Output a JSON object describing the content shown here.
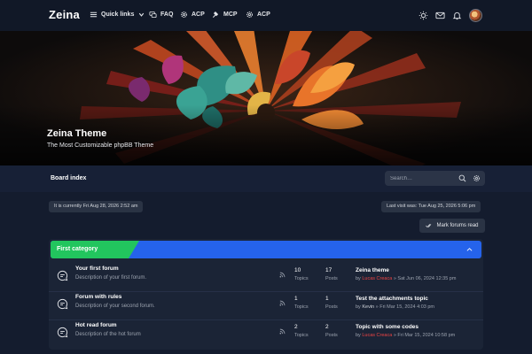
{
  "navbar": {
    "logo": "Zeina",
    "items": [
      {
        "label": "Quick links"
      },
      {
        "label": "FAQ"
      },
      {
        "label": "ACP"
      },
      {
        "label": "MCP"
      },
      {
        "label": "ACP"
      }
    ],
    "right_icons": [
      "sun-icon",
      "mail-icon",
      "bell-icon",
      "avatar"
    ]
  },
  "hero": {
    "title": "Zeina Theme",
    "subtitle": "The Most Customizable phpBB Theme"
  },
  "breadcrumb": {
    "label": "Board index"
  },
  "search": {
    "placeholder": "Search…"
  },
  "info": {
    "current_time": "It is currently Fri Aug 28, 2026 2:52 am",
    "last_visit": "Last visit was: Tue Aug 25, 2026 5:06 pm",
    "mark_read_label": "Mark forums read"
  },
  "category": {
    "title": "First category",
    "forums": [
      {
        "title": "Your first forum",
        "description": "Description of your first forum.",
        "topics": "10",
        "topics_label": "Topics",
        "posts": "17",
        "posts_label": "Posts",
        "last_title": "Zeina theme",
        "by": "by",
        "author": "Lucas Creaca",
        "author_color": "#ef4444",
        "date": "» Sat Jun 06, 2024 12:35 pm"
      },
      {
        "title": "Forum with rules",
        "description": "Description of your second forum.",
        "topics": "1",
        "topics_label": "Topics",
        "posts": "1",
        "posts_label": "Posts",
        "last_title": "Test the attachments topic",
        "by": "by",
        "author": "Kevin",
        "author_color": "#d1d5db",
        "date": "» Fri Mar 15, 2024 4:03 pm"
      },
      {
        "title": "Hot read forum",
        "description": "Description of the hot forum",
        "topics": "2",
        "topics_label": "Topics",
        "posts": "2",
        "posts_label": "Posts",
        "last_title": "Topic with some codes",
        "by": "by",
        "author": "Lucas Creaca",
        "author_color": "#ef4444",
        "date": "» Fri Mar 15, 2024 10:58 pm"
      }
    ]
  },
  "colors": {
    "background": "#141c2e",
    "navbar": "#111827",
    "category_blue": "#2563eb",
    "category_green": "#22c55e",
    "author_red": "#ef4444"
  }
}
